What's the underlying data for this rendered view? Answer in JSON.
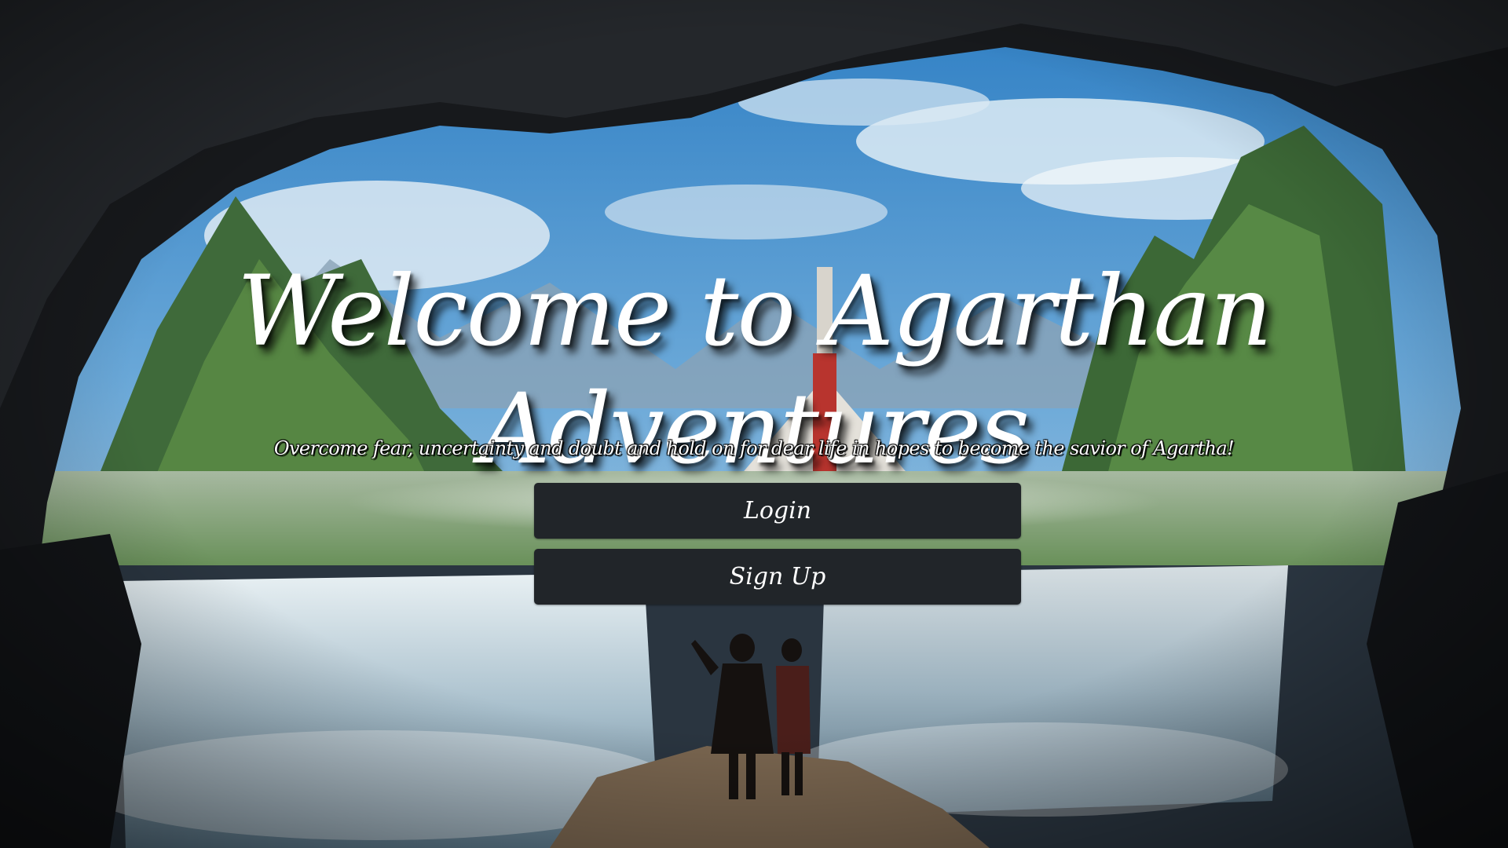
{
  "hero": {
    "title": "Welcome to Agarthan Adventures",
    "tagline": "Overcome fear, uncertainty and doubt and hold on for dear life in hopes to become the savior of Agartha!"
  },
  "actions": {
    "login_label": "Login",
    "signup_label": "Sign Up"
  },
  "colors": {
    "button_bg": "#212529",
    "text": "#ffffff"
  }
}
